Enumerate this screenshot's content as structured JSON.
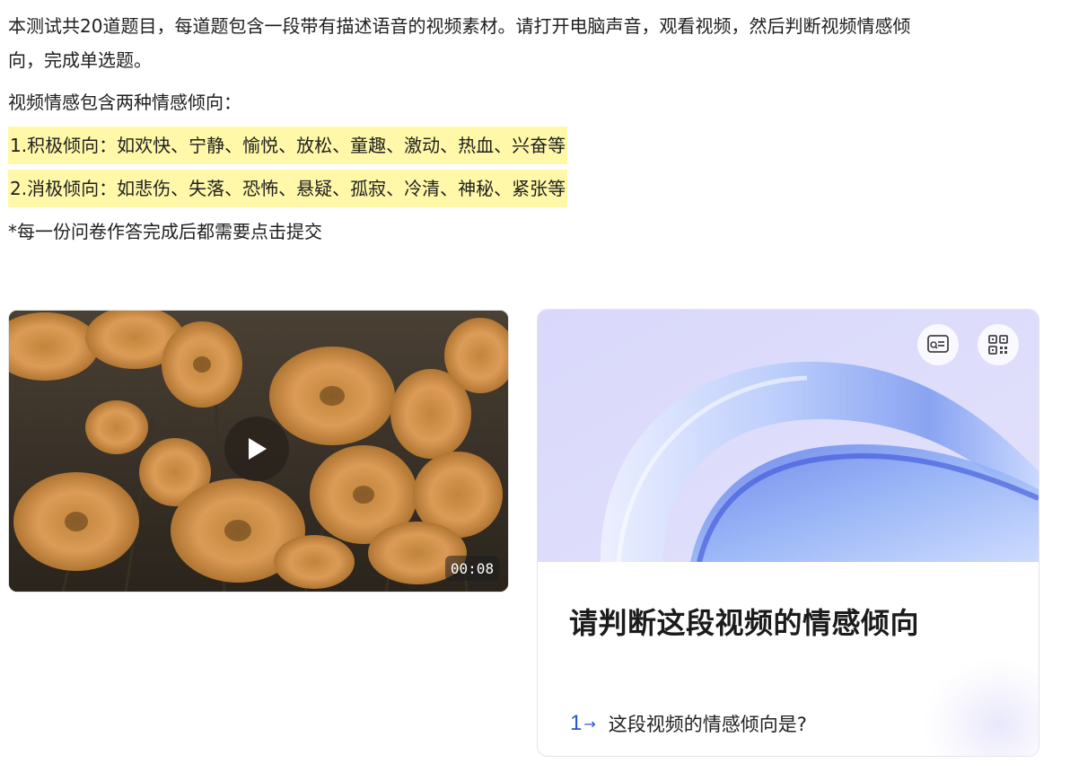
{
  "intro": {
    "paragraph1": "本测试共20道题目，每道题包含一段带有描述语音的视频素材。请打开电脑声音，观看视频，然后判断视频情感倾向，完成单选题。",
    "paragraph1_line1": "本测试共20道题目，每道题包含一段带有描述语音的视频素材。请打开电脑声音，观看视频，然后判断视频情感倾",
    "paragraph1_line2": "向，完成单选题。",
    "paragraph2": "视频情感包含两种情感倾向：",
    "positive": "1.积极倾向：如欢快、宁静、愉悦、放松、童趣、激动、热血、兴奋等",
    "negative": "2.消极倾向：如悲伤、失落、恐怖、悬疑、孤寂、冷清、神秘、紧张等",
    "note": "*每一份问卷作答完成后都需要点击提交"
  },
  "video": {
    "duration": "00:08",
    "play_icon": "play-icon"
  },
  "card": {
    "title": "请判断这段视频的情感倾向",
    "icons": [
      "survey-icon",
      "qr-code-icon"
    ],
    "question": {
      "number": "1",
      "arrow": "→",
      "text": "这段视频的情感倾向是?"
    }
  },
  "colors": {
    "highlight": "#fff8a8",
    "accent_blue": "#2b55d6",
    "hero_bg": "#dcdcfa"
  }
}
